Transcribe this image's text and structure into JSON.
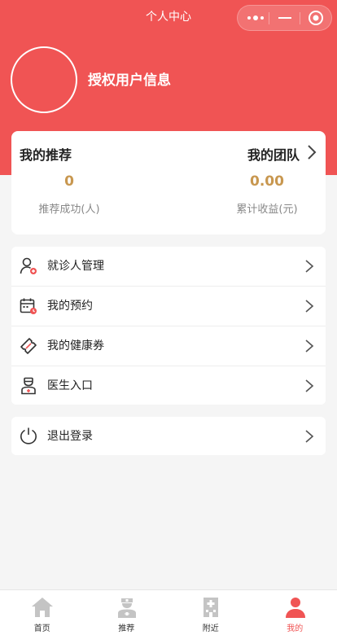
{
  "header": {
    "title": "个人中心",
    "auth_text": "授权用户信息"
  },
  "stats": {
    "left_title": "我的推荐",
    "right_title": "我的团队",
    "left_value": "0",
    "left_label": "推荐成功(人)",
    "right_value": "0.00",
    "right_label": "累计收益(元)"
  },
  "menu": {
    "items": [
      {
        "label": "就诊人管理",
        "icon": "patient-user-icon"
      },
      {
        "label": "我的预约",
        "icon": "calendar-icon"
      },
      {
        "label": "我的健康券",
        "icon": "ticket-icon"
      },
      {
        "label": "医生入口",
        "icon": "doctor-icon"
      }
    ],
    "logout_label": "退出登录"
  },
  "tabbar": {
    "items": [
      {
        "label": "首页",
        "icon": "home-icon"
      },
      {
        "label": "推荐",
        "icon": "nurse-icon"
      },
      {
        "label": "附近",
        "icon": "hospital-icon"
      },
      {
        "label": "我的",
        "icon": "person-icon"
      }
    ],
    "active_index": 3
  },
  "colors": {
    "brand": "#f05454",
    "accent_value": "#c8974f",
    "inactive_icon": "#c4c4c4"
  }
}
